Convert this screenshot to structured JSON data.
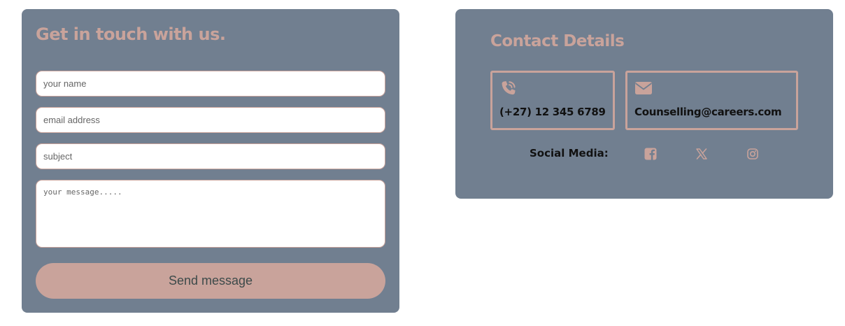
{
  "form": {
    "title": "Get in touch with us.",
    "name_placeholder": "your name",
    "email_placeholder": "email address",
    "subject_placeholder": "subject",
    "message_placeholder": "your message.....",
    "send_label": "Send message"
  },
  "contact": {
    "title": "Contact Details",
    "phone": {
      "icon": "phone-volume-icon",
      "text": "(+27) 12 345 6789"
    },
    "email": {
      "icon": "envelope-icon",
      "text": "Counselling@careers.com"
    },
    "social_label": "Social Media:",
    "social_icons": [
      "facebook-icon",
      "x-twitter-icon",
      "instagram-icon"
    ]
  },
  "colors": {
    "card_background": "#717f90",
    "accent": "#c9a39b",
    "text_dark": "#111111"
  }
}
